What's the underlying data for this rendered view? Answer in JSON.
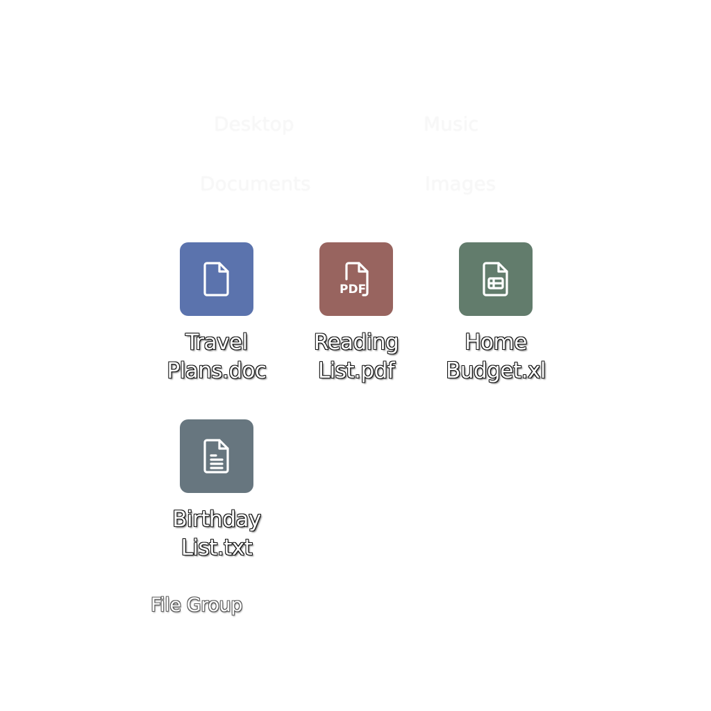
{
  "background_labels": [
    {
      "id": "desktop",
      "text": "Desktop"
    },
    {
      "id": "music",
      "text": "Music"
    },
    {
      "id": "documents",
      "text": "Documents"
    },
    {
      "id": "images",
      "text": "Images"
    }
  ],
  "files": [
    {
      "line1": "Travel",
      "line2": "Plans.doc",
      "icon": "document-icon",
      "color": "#5b73ad"
    },
    {
      "line1": "Reading",
      "line2": "List.pdf",
      "icon": "pdf-icon",
      "color": "#98645f"
    },
    {
      "line1": "Home",
      "line2": "Budget.xl",
      "icon": "spreadsheet-icon",
      "color": "#627c6c"
    },
    {
      "line1": "Birthday",
      "line2": "List.txt",
      "icon": "text-file-icon",
      "color": "#67767f"
    }
  ],
  "group_label": "File Group"
}
